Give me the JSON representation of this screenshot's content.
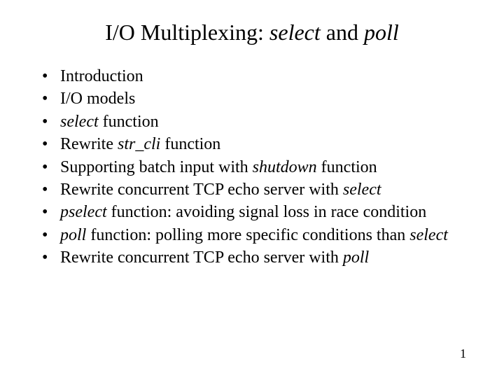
{
  "title": {
    "pre": "I/O Multiplexing: ",
    "em1": "select",
    "mid": " and ",
    "em2": "poll"
  },
  "bullets": {
    "b1": {
      "t1": "Introduction"
    },
    "b2": {
      "t1": "I/O models"
    },
    "b3": {
      "em1": "select",
      "t2": " function"
    },
    "b4": {
      "t1": "Rewrite ",
      "em1": "str_cli",
      "t2": " function"
    },
    "b5": {
      "t1": "Supporting batch input with ",
      "em1": "shutdown",
      "t2": " function"
    },
    "b6": {
      "t1": "Rewrite concurrent TCP echo server with ",
      "em1": "select"
    },
    "b7": {
      "em1": "pselect",
      "t2": " function: avoiding signal loss in race condition"
    },
    "b8": {
      "em1": "poll",
      "t2": " function: polling more specific conditions than ",
      "em2": "select"
    },
    "b9": {
      "t1": "Rewrite concurrent TCP echo server with ",
      "em1": "poll"
    }
  },
  "page_number": "1"
}
